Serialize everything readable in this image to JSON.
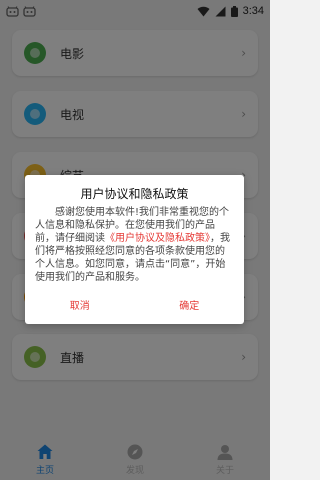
{
  "status_bar": {
    "time": "3:34"
  },
  "menu": {
    "items": [
      {
        "label": "电影",
        "color": "#4caf50"
      },
      {
        "label": "电视",
        "color": "#29b6f6"
      },
      {
        "label": "综艺",
        "color": "#fbc02d"
      },
      {
        "label": "",
        "color": "#ef5350"
      },
      {
        "label": "",
        "color": "#ff9800"
      },
      {
        "label": "直播",
        "color": "#8bc34a"
      }
    ],
    "chevron": "›"
  },
  "bottom_nav": {
    "items": [
      {
        "label": "主页",
        "active": true
      },
      {
        "label": "发现",
        "active": false
      },
      {
        "label": "关于",
        "active": false
      }
    ]
  },
  "dialog": {
    "title": "用户协议和隐私政策",
    "body_part1": "感谢您使用本软件!我们非常重视您的个人信息和隐私保护。在您使用我们的产品前，请仔细阅读",
    "body_link": "《用户协议及隐私政策》",
    "body_part2": "，我们将严格按照经您同意的各项条款使用您的个人信息。如您同意，请点击“同意”，开始使用我们的产品和服务。",
    "cancel_label": "取消",
    "confirm_label": "确定"
  },
  "colors": {
    "accent": "#e53935",
    "nav_active": "#1e88e5"
  }
}
